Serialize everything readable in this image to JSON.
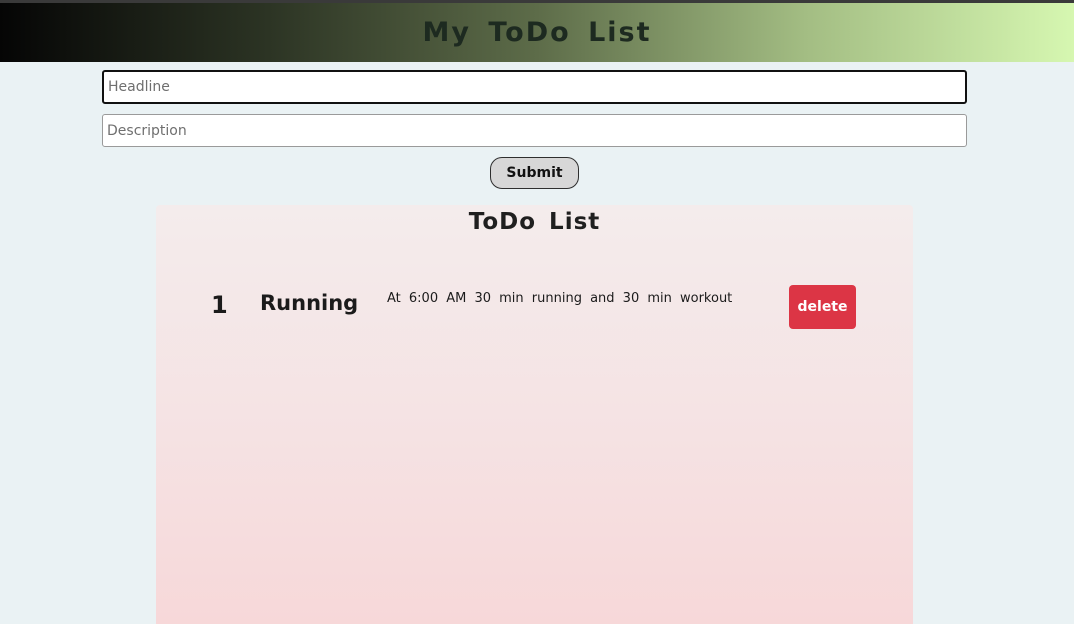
{
  "header": {
    "title": "My ToDo List"
  },
  "form": {
    "headline_placeholder": "Headline",
    "headline_value": "",
    "description_placeholder": "Description",
    "description_value": "",
    "submit_label": "Submit"
  },
  "todo_list": {
    "title": "ToDo List",
    "items": [
      {
        "number": "1",
        "headline": "Running",
        "description": "At 6:00 AM 30 min running and 30 min workout",
        "delete_label": "delete"
      }
    ]
  },
  "colors": {
    "page_background": "#eaf2f4",
    "header_gradient_start": "#050505",
    "header_gradient_end": "#d6f7b1",
    "delete_button": "#dc3545",
    "submit_button": "#d7d7d7",
    "list_panel": "#f5e2e3"
  }
}
